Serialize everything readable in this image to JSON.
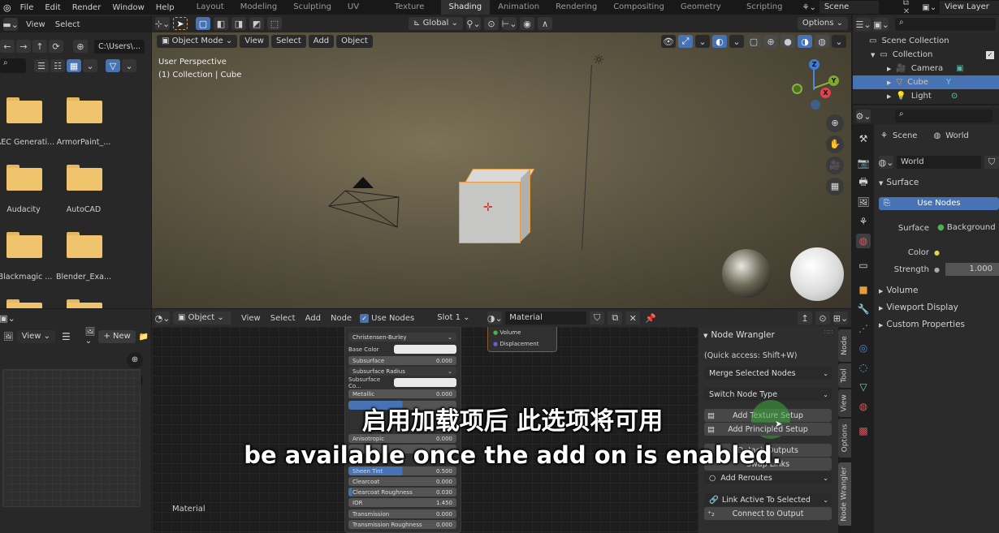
{
  "menu": [
    "File",
    "Edit",
    "Render",
    "Window",
    "Help"
  ],
  "workspaces": [
    "Layout",
    "Modeling",
    "Sculpting",
    "UV Editing",
    "Texture Paint",
    "Shading",
    "Animation",
    "Rendering",
    "Compositing",
    "Geometry Nodes",
    "Scripting"
  ],
  "active_workspace": "Shading",
  "scene": {
    "name": "Scene",
    "view_layer": "View Layer"
  },
  "file_browser": {
    "menus": [
      "View",
      "Select"
    ],
    "path": "C:\\Users\\...",
    "folders": [
      "AEC Generati...",
      "ArmorPaint_...",
      "Audacity",
      "AutoCAD",
      "Blackmagic ...",
      "Blender_Exa..."
    ]
  },
  "viewport": {
    "mode": "Object Mode",
    "menus": [
      "View",
      "Select",
      "Add",
      "Object"
    ],
    "transform_orientation": "Global",
    "options_label": "Options",
    "overlay_line1": "User Perspective",
    "overlay_line2": "(1) Collection | Cube",
    "gizmo": {
      "x": "X",
      "y": "Y",
      "z": "Z"
    }
  },
  "outliner": {
    "root": "Scene Collection",
    "collection": "Collection",
    "items": [
      "Camera",
      "Cube",
      "Light"
    ],
    "selected": "Cube"
  },
  "properties": {
    "breadcrumb": [
      "Scene",
      "World"
    ],
    "world_name": "World",
    "surface_panel": "Surface",
    "use_nodes_label": "Use Nodes",
    "surface_label": "Surface",
    "surface_value": "Background",
    "color_label": "Color",
    "strength_label": "Strength",
    "strength_value": "1.000",
    "collapsed_panels": [
      "Volume",
      "Viewport Display",
      "Custom Properties"
    ]
  },
  "image_editor": {
    "view_label": "View",
    "new_label": "New"
  },
  "node_editor": {
    "object_label": "Object",
    "menus": [
      "View",
      "Select",
      "Add",
      "Node"
    ],
    "use_nodes_label": "Use Nodes",
    "slot": "Slot 1",
    "material": "Material",
    "canvas_label": "Material",
    "output_sockets": [
      "Volume",
      "Displacement"
    ],
    "bsdf": {
      "subsurface_method": "Christensen-Burley",
      "rows": [
        {
          "label": "Base Color",
          "value": ""
        },
        {
          "label": "Subsurface",
          "value": "0.000"
        },
        {
          "label": "Subsurface Radius",
          "value": ""
        },
        {
          "label": "Subsurface Co...",
          "value": ""
        },
        {
          "label": "Metallic",
          "value": "0.000"
        },
        {
          "label": "Anisotropic",
          "value": "0.000"
        },
        {
          "label": "Sheen Tint",
          "value": "0.500"
        },
        {
          "label": "Clearcoat",
          "value": "0.000"
        },
        {
          "label": "Clearcoat Roughness",
          "value": "0.030"
        },
        {
          "label": "IOR",
          "value": "1.450"
        },
        {
          "label": "Transmission",
          "value": "0.000"
        },
        {
          "label": "Transmission Roughness",
          "value": "0.000"
        }
      ]
    }
  },
  "node_wrangler": {
    "title": "Node Wrangler",
    "quick_access": "(Quick access: Shift+W)",
    "merge": "Merge Selected Nodes",
    "switch": "Switch Node Type",
    "add_texture": "Add Texture Setup",
    "add_principled": "Add Principled Setup",
    "detach": "Detach Outputs",
    "swap": "Swap Links",
    "reroutes": "Add Reroutes",
    "link_active": "Link Active To Selected",
    "connect": "Connect to Output",
    "tabs": [
      "Node",
      "Tool",
      "View",
      "Options",
      "Node Wrangler"
    ]
  },
  "subtitles": {
    "zh": "启用加载项后 此选项将可用",
    "en": "be available once the add on is enabled."
  }
}
